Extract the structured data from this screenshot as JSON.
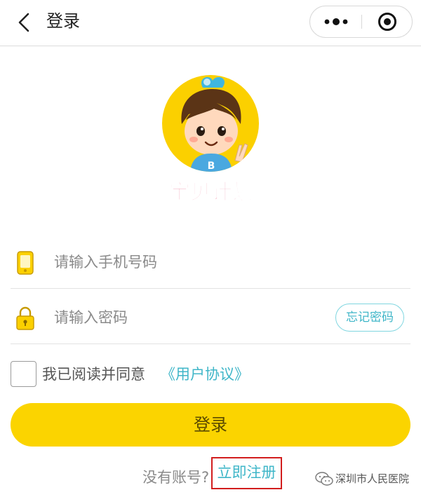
{
  "navbar": {
    "title": "登录",
    "icons": {
      "back": "chevron-left-icon",
      "more": "more-dots-icon",
      "close": "target-close-icon"
    }
  },
  "brand": {
    "name": "宝贝计划",
    "logo_icon": "child-mascot-logo",
    "shirt_letter": "B",
    "colors": {
      "logo_bg": "#fbd000"
    }
  },
  "form": {
    "phone": {
      "placeholder": "请输入手机号码",
      "value": "",
      "icon": "phone-icon"
    },
    "password": {
      "placeholder": "请输入密码",
      "value": "",
      "icon": "lock-icon"
    },
    "forgot_label": "忘记密码",
    "agreement": {
      "checked": false,
      "text": "我已阅读并同意",
      "link": "《用户协议》"
    },
    "login_label": "登录"
  },
  "register": {
    "prompt": "没有账号?",
    "link": "立即注册"
  },
  "watermark": {
    "text": "深圳市人民医院",
    "icon": "wechat-icon"
  },
  "colors": {
    "accent": "#fbd400",
    "link": "#3fb6c8",
    "highlight_box": "#d21e1e"
  }
}
